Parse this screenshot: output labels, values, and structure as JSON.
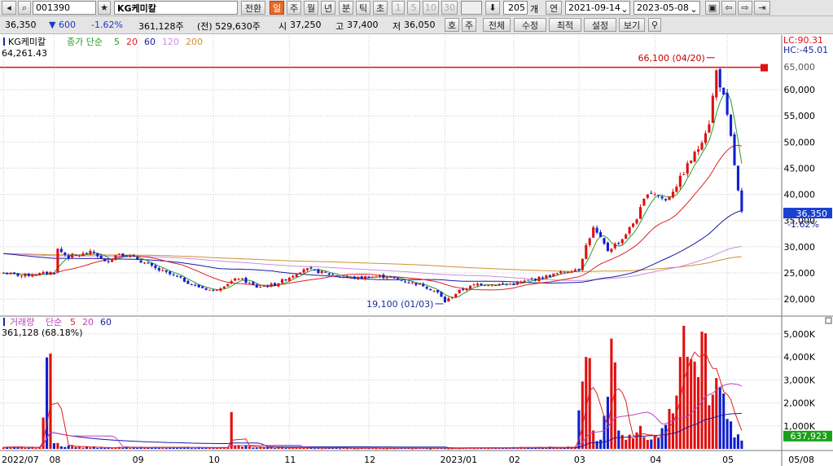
{
  "toolbar": {
    "stock_code": "001390",
    "stock_name": "KG케미칼",
    "mode_buttons": [
      "전환",
      "일",
      "주",
      "월",
      "년",
      "분",
      "틱",
      "초"
    ],
    "active_mode": "일",
    "minute_buttons": [
      "1",
      "5",
      "10",
      "30"
    ],
    "count_value": "205",
    "count_unit": "개",
    "range_label": "연",
    "start_date": "2021-09-14",
    "end_date": "2023-05-08"
  },
  "quote": {
    "price": "36,350",
    "change": "▼ 600",
    "change_pct": "-1.62%",
    "volume": "361,128주",
    "prev_volume": "(전) 529,630주",
    "open_label": "시",
    "open": "37,250",
    "high_label": "고",
    "high": "37,400",
    "low_label": "저",
    "low": "36,050",
    "buttons": [
      "호",
      "주",
      "전체",
      "수정",
      "최적",
      "설정",
      "보기"
    ]
  },
  "chart_data": {
    "type": "candlestick",
    "price_panel": {
      "legend_name": "KG케미칼",
      "ma_label": "종가 단순",
      "ma_periods": [
        "5",
        "20",
        "60",
        "120",
        "200"
      ],
      "ma_colors": {
        "5": "#2a9a2a",
        "20": "#dd2222",
        "60": "#1a1aa0",
        "120": "#c890e0",
        "200": "#d09030"
      },
      "top_left_value": "64,261.43",
      "ylim": [
        18000,
        67000
      ],
      "y_ticks": [
        "60,000",
        "55,000",
        "50,000",
        "45,000",
        "40,000",
        "35,000",
        "30,000",
        "25,000",
        "20,000"
      ],
      "y_tick_values": [
        60000,
        55000,
        50000,
        45000,
        40000,
        35000,
        30000,
        25000,
        20000
      ],
      "top_partial_tick": "65,000",
      "lc_label": "LC:90.31",
      "hc_label": "HC:-45.01",
      "high_marker_label": "66,100 (04/20)",
      "high_marker_value": 66100,
      "low_marker_label": "19,100 (01/03)",
      "low_marker_value": 19100,
      "last_price_label": "36,350",
      "last_price_value": 36350,
      "last_change_label": "-1.62%",
      "hline_value": 64261.43
    },
    "volume_panel": {
      "legend_name": "거래량",
      "ma_label": "단순",
      "ma_periods": [
        "5",
        "20",
        "60"
      ],
      "ma_colors": {
        "5": "#dd2222",
        "20": "#c040c0",
        "60": "#1a1aa0"
      },
      "info": "361,128 (68.18%)",
      "ylim": [
        0,
        5600000
      ],
      "y_ticks": [
        "5,000K",
        "4,000K",
        "3,000K",
        "2,000K",
        "1,000K"
      ],
      "y_tick_values": [
        5000000,
        4000000,
        3000000,
        2000000,
        1000000
      ],
      "last_volume_label": "637,923"
    },
    "x_axis": {
      "labels": [
        "2022/07",
        "08",
        "09",
        "10",
        "11",
        "12",
        "2023/01",
        "02",
        "03",
        "04",
        "05"
      ],
      "label_index": [
        0,
        14,
        37,
        58,
        79,
        101,
        122,
        141,
        159,
        180,
        200
      ],
      "right_label": "05/08"
    },
    "n_bars": 205,
    "price_anchors": [
      [
        0,
        25000
      ],
      [
        5,
        24500
      ],
      [
        10,
        24800
      ],
      [
        14,
        25200
      ],
      [
        15,
        29500
      ],
      [
        18,
        28000
      ],
      [
        25,
        29000
      ],
      [
        28,
        27000
      ],
      [
        32,
        28800
      ],
      [
        37,
        27600
      ],
      [
        42,
        25800
      ],
      [
        48,
        24200
      ],
      [
        53,
        22500
      ],
      [
        58,
        21600
      ],
      [
        62,
        23000
      ],
      [
        65,
        24000
      ],
      [
        70,
        22300
      ],
      [
        75,
        22800
      ],
      [
        79,
        24200
      ],
      [
        83,
        25800
      ],
      [
        88,
        25100
      ],
      [
        93,
        24300
      ],
      [
        98,
        24000
      ],
      [
        101,
        24300
      ],
      [
        106,
        24300
      ],
      [
        111,
        23400
      ],
      [
        116,
        22600
      ],
      [
        120,
        21200
      ],
      [
        122,
        19500
      ],
      [
        126,
        21600
      ],
      [
        131,
        22900
      ],
      [
        136,
        22800
      ],
      [
        141,
        22900
      ],
      [
        146,
        23700
      ],
      [
        151,
        24500
      ],
      [
        156,
        25400
      ],
      [
        159,
        25800
      ],
      [
        161,
        30200
      ],
      [
        163,
        33500
      ],
      [
        165,
        31500
      ],
      [
        167,
        29300
      ],
      [
        171,
        31500
      ],
      [
        175,
        35500
      ],
      [
        178,
        40500
      ],
      [
        180,
        40200
      ],
      [
        183,
        38800
      ],
      [
        186,
        41800
      ],
      [
        189,
        45500
      ],
      [
        192,
        48800
      ],
      [
        195,
        53800
      ],
      [
        197,
        63500
      ],
      [
        199,
        58500
      ],
      [
        201,
        50800
      ],
      [
        203,
        40500
      ],
      [
        204,
        36400
      ]
    ],
    "volume_anchors": [
      [
        0,
        60000
      ],
      [
        10,
        60000
      ],
      [
        13,
        4150000
      ],
      [
        14,
        250000
      ],
      [
        20,
        80000
      ],
      [
        40,
        60000
      ],
      [
        62,
        60000
      ],
      [
        63,
        1600000
      ],
      [
        64,
        150000
      ],
      [
        70,
        60000
      ],
      [
        100,
        40000
      ],
      [
        122,
        30000
      ],
      [
        158,
        80000
      ],
      [
        161,
        4000000
      ],
      [
        162,
        3950000
      ],
      [
        163,
        800000
      ],
      [
        165,
        400000
      ],
      [
        168,
        4800000
      ],
      [
        170,
        800000
      ],
      [
        180,
        600000
      ],
      [
        182,
        900000
      ],
      [
        187,
        4000000
      ],
      [
        191,
        3800000
      ],
      [
        193,
        5100000
      ],
      [
        195,
        1900000
      ],
      [
        198,
        2700000
      ],
      [
        200,
        1300000
      ],
      [
        202,
        500000
      ],
      [
        204,
        361128
      ]
    ]
  }
}
